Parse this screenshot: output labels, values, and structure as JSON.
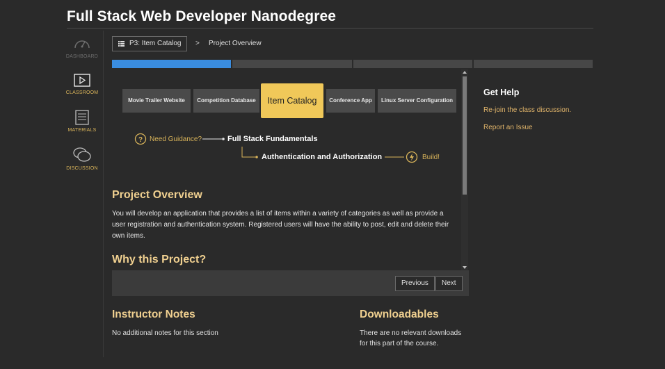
{
  "header": {
    "title": "Full Stack Web Developer Nanodegree"
  },
  "sidebar": {
    "items": [
      {
        "label": "DASHBOARD",
        "icon": "dashboard-icon"
      },
      {
        "label": "CLASSROOM",
        "icon": "play-icon"
      },
      {
        "label": "MATERIALS",
        "icon": "document-icon"
      },
      {
        "label": "DISCUSSION",
        "icon": "chat-icon"
      }
    ]
  },
  "breadcrumb": {
    "button": "P3: Item Catalog",
    "separator": ">",
    "current": "Project Overview"
  },
  "progress": {
    "segments": 4,
    "fill": [
      1.0,
      0,
      0,
      0
    ],
    "color": "#3a8de0"
  },
  "projects": {
    "tabs": [
      "Movie Trailer Website",
      "Competition Database",
      "Item Catalog",
      "Conference App",
      "Linux Server Configuration"
    ],
    "active": "Item Catalog"
  },
  "flow": {
    "guidance": "Need Guidance?",
    "step1": "Full Stack Fundamentals",
    "step2": "Authentication and Authorization",
    "build": "Build!"
  },
  "overview": {
    "heading": "Project Overview",
    "text": "You will develop an application that provides a list of items within a variety of categories as well as provide a user registration and authentication system. Registered users will have the ability to post, edit and delete their own items.",
    "why_heading": "Why this Project?"
  },
  "nav": {
    "previous": "Previous",
    "next": "Next"
  },
  "help": {
    "heading": "Get Help",
    "link1": "Re-join the class discussion.",
    "link2": "Report an Issue"
  },
  "notes": {
    "heading": "Instructor Notes",
    "text": "No additional notes for this section"
  },
  "downloads": {
    "heading": "Downloadables",
    "line1": "There are no relevant downloads",
    "line2": "for this part of the course."
  },
  "colors": {
    "accent": "#f0c859",
    "heading": "#f0d090",
    "link": "#e0b46a",
    "background": "#2a2a2a"
  }
}
